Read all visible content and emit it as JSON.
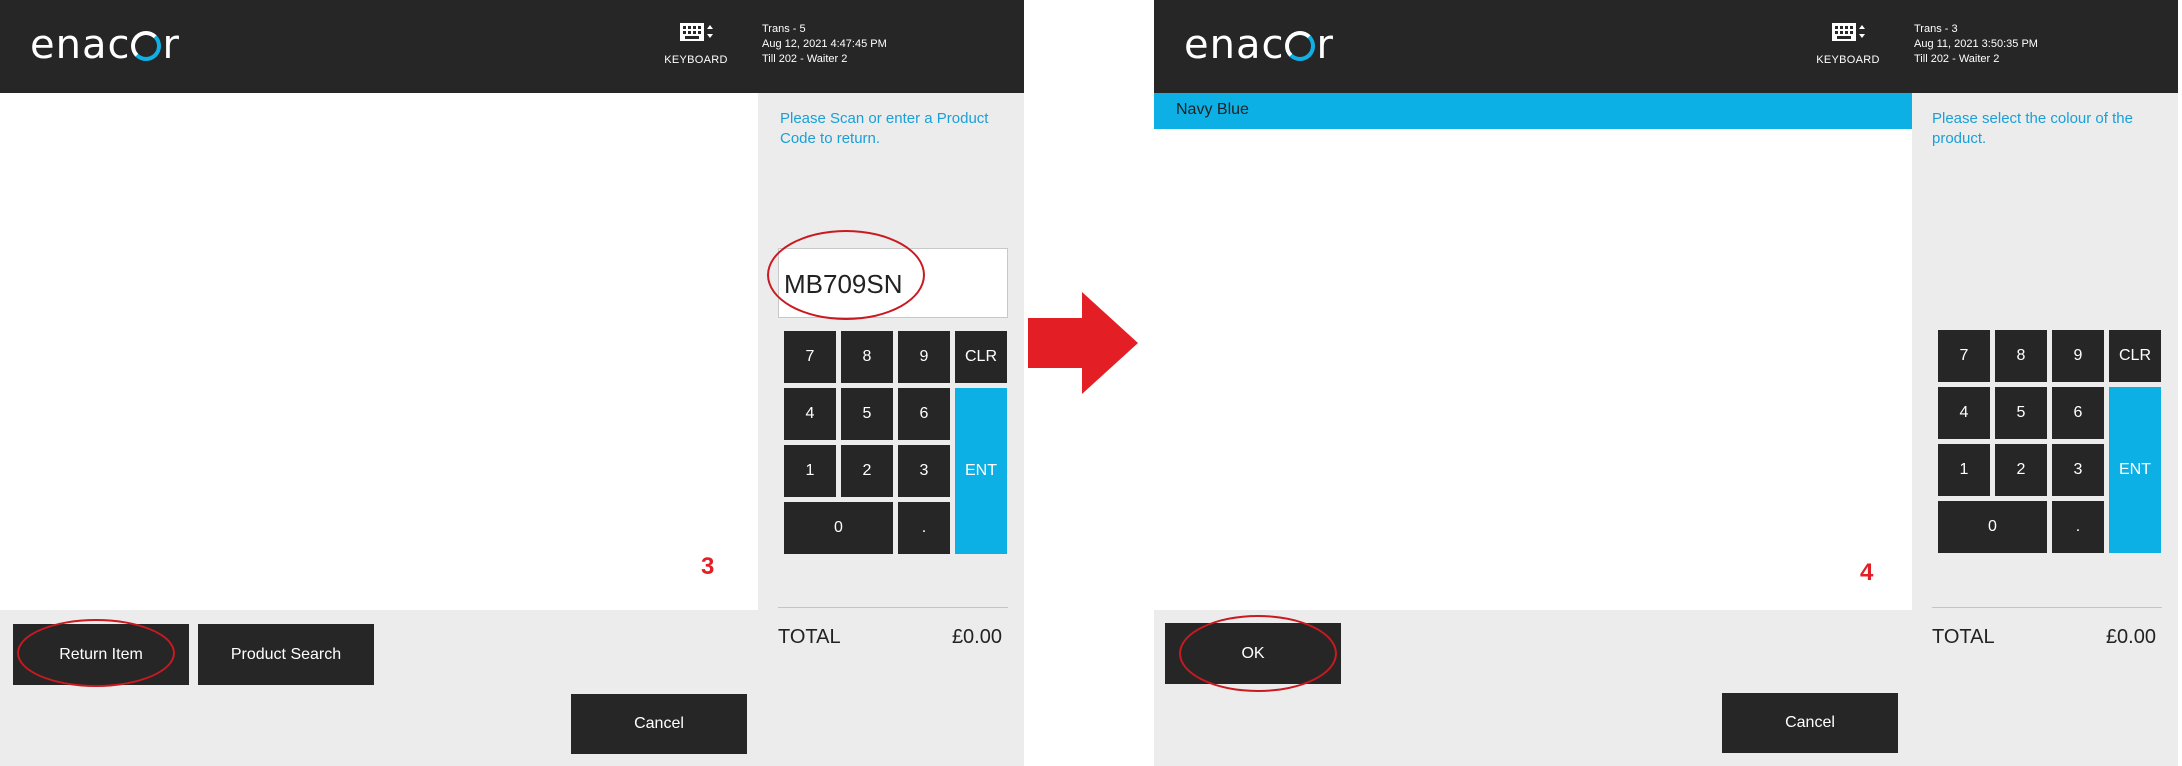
{
  "colors": {
    "header_bg": "#262626",
    "accent": "#0cb0e5",
    "panel_bg": "#ececec",
    "annotation_red": "#e31e25"
  },
  "left": {
    "brand": {
      "prefix": "enac",
      "suffix": "r"
    },
    "header": {
      "keyboard_label": "KEYBOARD",
      "trans": "Trans - 5",
      "datetime": "Aug 12, 2021 4:47:45 PM",
      "till": "Till 202 - Waiter 2"
    },
    "instruction": "Please Scan or enter a Product Code to return.",
    "input_value": "MB709SN",
    "keypad": {
      "k7": "7",
      "k8": "8",
      "k9": "9",
      "clr": "CLR",
      "k4": "4",
      "k5": "5",
      "k6": "6",
      "ent": "ENT",
      "k1": "1",
      "k2": "2",
      "k3": "3",
      "k0": "0",
      "dot": "."
    },
    "total_label": "TOTAL",
    "total_value": "£0.00",
    "step": "3",
    "buttons": {
      "return_item": "Return Item",
      "product_search": "Product Search",
      "cancel": "Cancel"
    }
  },
  "right": {
    "brand": {
      "prefix": "enac",
      "suffix": "r"
    },
    "header": {
      "keyboard_label": "KEYBOARD",
      "trans": "Trans - 3",
      "datetime": "Aug 11, 2021 3:50:35 PM",
      "till": "Till 202 - Waiter 2"
    },
    "selected_colour": "Navy Blue",
    "instruction": "Please select the colour of the product.",
    "keypad": {
      "k7": "7",
      "k8": "8",
      "k9": "9",
      "clr": "CLR",
      "k4": "4",
      "k5": "5",
      "k6": "6",
      "ent": "ENT",
      "k1": "1",
      "k2": "2",
      "k3": "3",
      "k0": "0",
      "dot": "."
    },
    "total_label": "TOTAL",
    "total_value": "£0.00",
    "step": "4",
    "buttons": {
      "ok": "OK",
      "cancel": "Cancel"
    }
  }
}
